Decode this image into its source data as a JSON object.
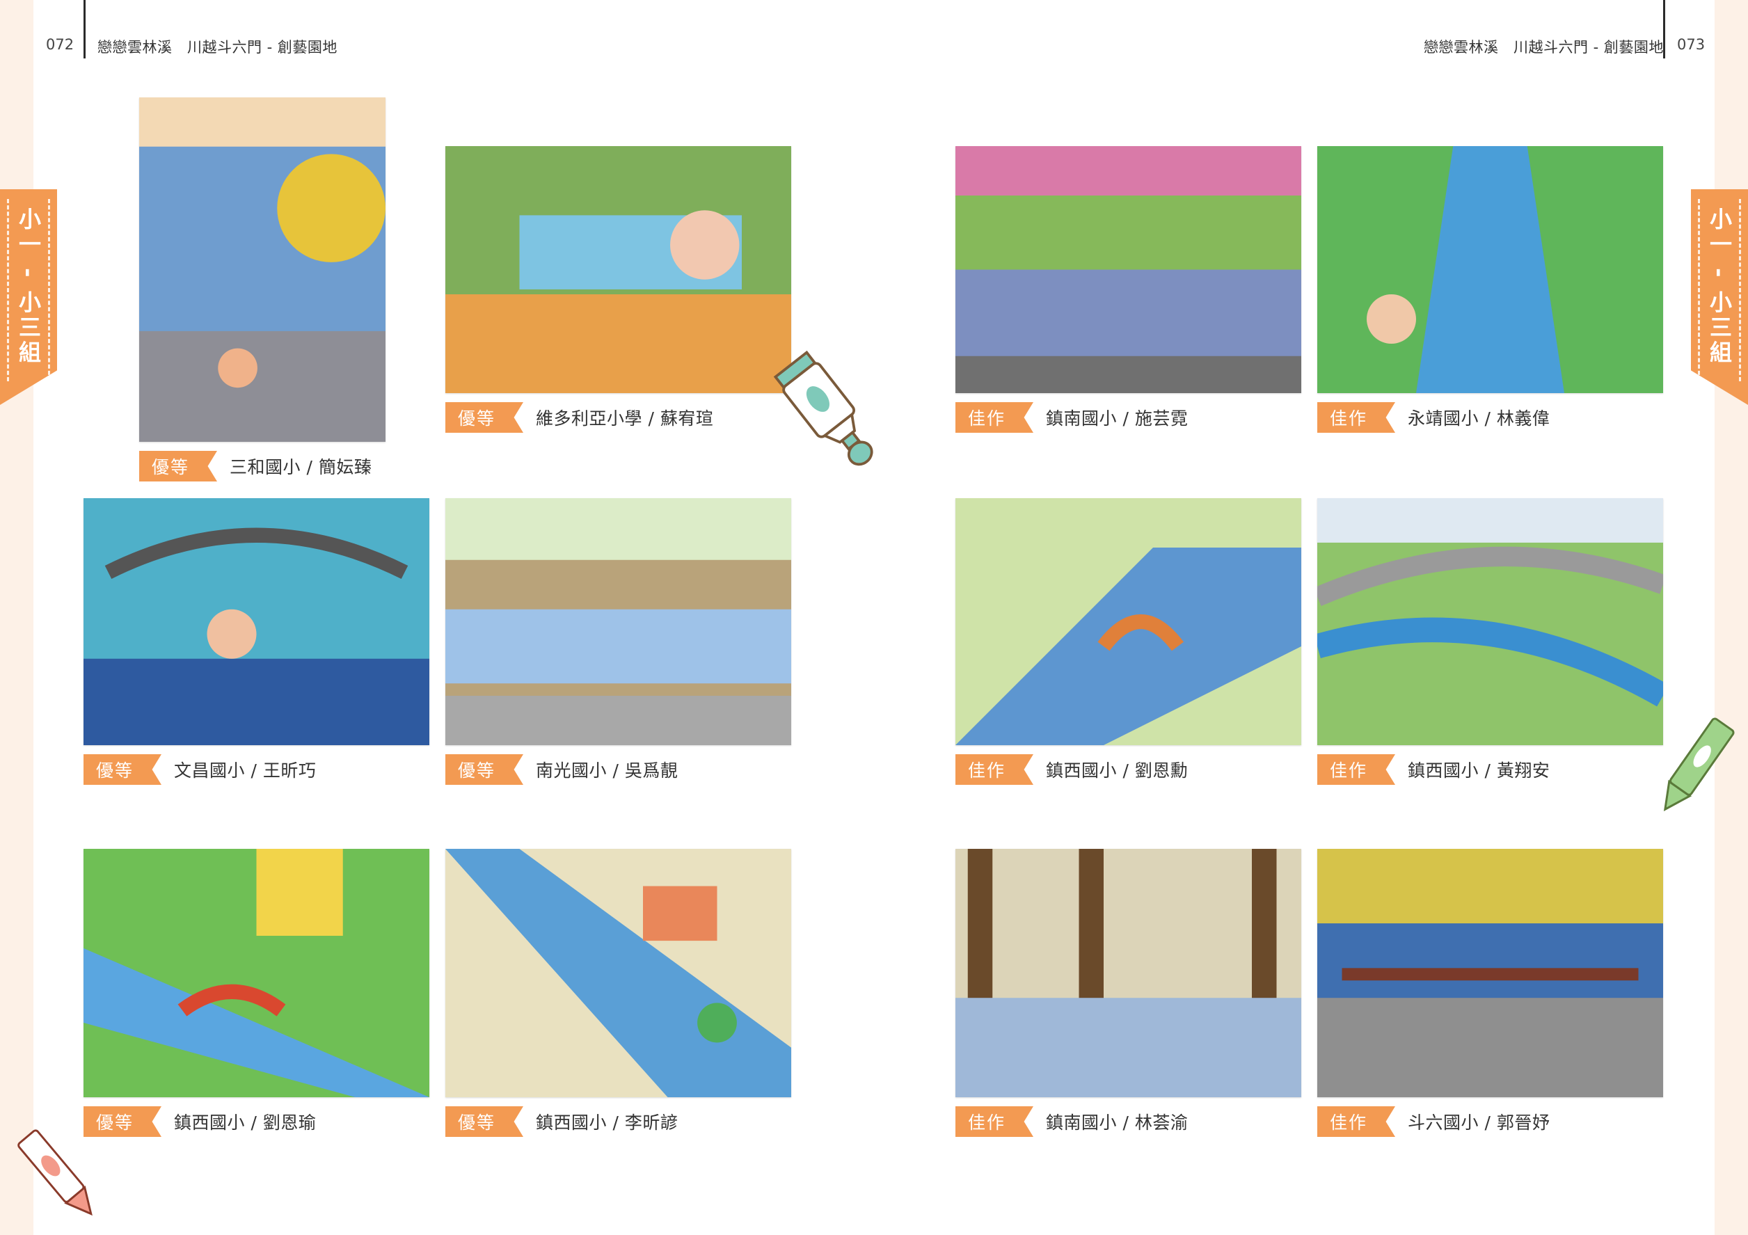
{
  "header": {
    "left_page_number": "072",
    "right_page_number": "073",
    "section_title": "戀戀雲林溪　川越斗六門 - 創藝園地"
  },
  "side_tab": {
    "label": "小一 - 小三組"
  },
  "artworks": [
    {
      "badge": "優等",
      "caption": "三和國小 / 簡妘臻",
      "palette": "#6f9dcf"
    },
    {
      "badge": "優等",
      "caption": "維多利亞小學 / 蘇宥瑄",
      "palette": "#7fae5a"
    },
    {
      "badge": "優等",
      "caption": "文昌國小 / 王昕巧",
      "palette": "#4fb0c9"
    },
    {
      "badge": "優等",
      "caption": "南光國小 / 吳爲靚",
      "palette": "#b9a37a"
    },
    {
      "badge": "優等",
      "caption": "鎮西國小 / 劉恩瑜",
      "palette": "#6fbf55"
    },
    {
      "badge": "優等",
      "caption": "鎮西國小 / 李昕諺",
      "palette": "#5a9fd6"
    },
    {
      "badge": "佳作",
      "caption": "鎮南國小 / 施芸霓",
      "palette": "#7d8fc0"
    },
    {
      "badge": "佳作",
      "caption": "永靖國小 / 林義偉",
      "palette": "#5fb65a"
    },
    {
      "badge": "佳作",
      "caption": "鎮西國小 / 劉恩勳",
      "palette": "#5d96d0"
    },
    {
      "badge": "佳作",
      "caption": "鎮西國小 / 黃翔安",
      "palette": "#8fc46a"
    },
    {
      "badge": "佳作",
      "caption": "鎮南國小 / 林荟渝",
      "palette": "#8a7a52"
    },
    {
      "badge": "佳作",
      "caption": "斗六國小 / 郭晉妤",
      "palette": "#3f6fb0"
    }
  ],
  "colors": {
    "accent": "#f39a52",
    "paint_tube": "#7fc9b9",
    "crayon_green": "#9fd38a",
    "crayon_red": "#f39a8a"
  }
}
